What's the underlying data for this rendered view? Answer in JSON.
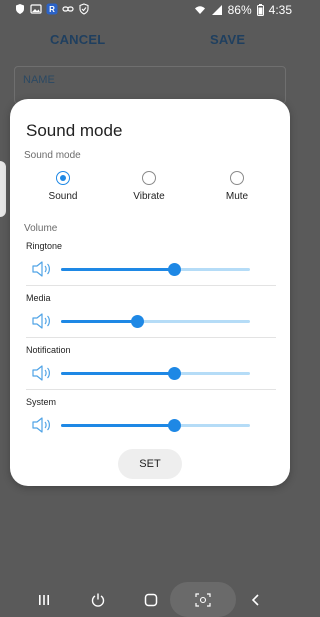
{
  "status_bar": {
    "battery_percent": "86%",
    "time": "4:35",
    "left_icons": [
      "shield-icon",
      "image-icon",
      "r-app-icon",
      "link-icon",
      "check-shield-icon"
    ],
    "right_icons": [
      "wifi-icon",
      "signal-icon",
      "battery-icon"
    ]
  },
  "background": {
    "cancel_label": "CANCEL",
    "save_label": "SAVE",
    "name_label": "NAME"
  },
  "dialog": {
    "title": "Sound mode",
    "mode_section_label": "Sound mode",
    "modes": [
      {
        "label": "Sound",
        "selected": true
      },
      {
        "label": "Vibrate",
        "selected": false
      },
      {
        "label": "Mute",
        "selected": false
      }
    ],
    "volume_section_label": "Volume",
    "volumes": [
      {
        "label": "Ringtone",
        "level": 0.6
      },
      {
        "label": "Media",
        "level": 0.4
      },
      {
        "label": "Notification",
        "level": 0.6
      },
      {
        "label": "System",
        "level": 0.6
      }
    ],
    "set_label": "SET"
  },
  "nav_bar": {
    "icons": [
      "recents-icon",
      "power-icon",
      "home-icon",
      "screen-capture-icon",
      "back-icon"
    ]
  },
  "colors": {
    "accent": "#1e88e5",
    "track_inactive": "#b5dcf7",
    "overlay_bg": "#5a5a5a"
  }
}
